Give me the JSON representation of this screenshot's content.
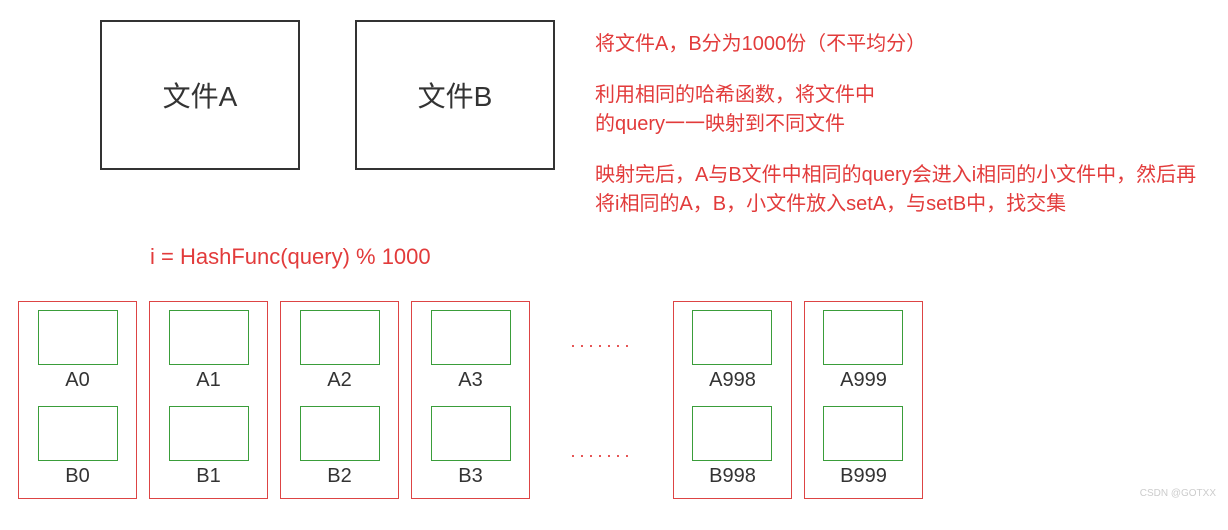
{
  "files": {
    "A": "文件A",
    "B": "文件B"
  },
  "annotations": {
    "line1": "将文件A，B分为1000份（不平均分）",
    "line2a": "利用相同的哈希函数，将文件中",
    "line2b": "的query一一映射到不同文件",
    "line3a": "映射完后，A与B文件中相同的query会进入i相同的小文件中，然后再",
    "line3b": "将i相同的A，B，小文件放入setA，与setB中，找交集"
  },
  "formula": "i  = HashFunc(query) % 1000",
  "groups_left": [
    {
      "a": "A0",
      "b": "B0"
    },
    {
      "a": "A1",
      "b": "B1"
    },
    {
      "a": "A2",
      "b": "B2"
    },
    {
      "a": "A3",
      "b": "B3"
    }
  ],
  "ellipsis_top": "·······",
  "ellipsis_bottom": "·······",
  "groups_right": [
    {
      "a": "A998",
      "b": "B998"
    },
    {
      "a": "A999",
      "b": "B999"
    }
  ],
  "watermark": "CSDN @GOTXX"
}
